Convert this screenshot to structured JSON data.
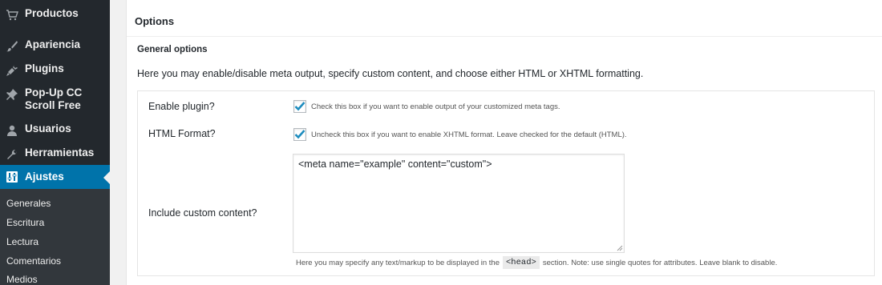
{
  "sidebar": {
    "items": [
      {
        "label": "Productos",
        "icon": "cart-icon"
      },
      {
        "label": "Apariencia",
        "icon": "paintbrush-icon"
      },
      {
        "label": "Plugins",
        "icon": "plugin-icon"
      },
      {
        "label": "Pop-Up CC Scroll Free",
        "icon": "pin-icon"
      },
      {
        "label": "Usuarios",
        "icon": "user-icon"
      },
      {
        "label": "Herramientas",
        "icon": "wrench-icon"
      },
      {
        "label": "Ajustes",
        "icon": "settings-icon",
        "current": true
      }
    ],
    "submenu": [
      "Generales",
      "Escritura",
      "Lectura",
      "Comentarios",
      "Medios"
    ]
  },
  "panel": {
    "title": "Options",
    "section_title": "General options",
    "intro": "Here you may enable/disable meta output, specify custom content, and choose either HTML or XHTML formatting.",
    "rows": {
      "enable": {
        "label": "Enable plugin?",
        "checked": true,
        "description": "Check this box if you want to enable output of your customized meta tags."
      },
      "format": {
        "label": "HTML Format?",
        "checked": true,
        "description": "Uncheck this box if you want to enable XHTML format. Leave checked for the default (HTML)."
      },
      "custom": {
        "label": "Include custom content?",
        "value": "<meta name=\"example\" content=\"custom\">",
        "help_before": "Here you may specify any text/markup to be displayed in the",
        "help_code": "<head>",
        "help_after": "section. Note: use single quotes for attributes. Leave blank to disable."
      }
    }
  },
  "colors": {
    "sidebar_bg": "#23282d",
    "active_bg": "#0073aa",
    "checkmark": "#1e8cbe"
  }
}
